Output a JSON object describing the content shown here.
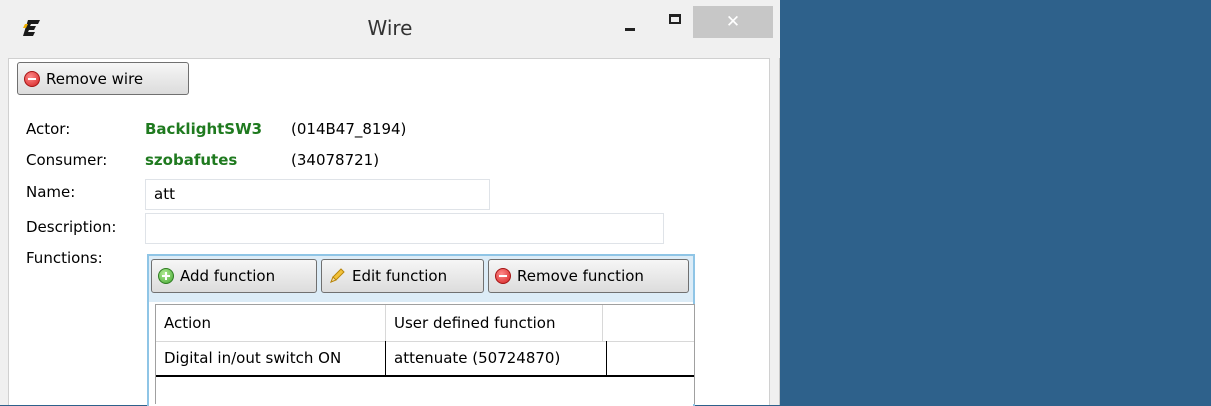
{
  "window": {
    "title": "Wire",
    "close_glyph": "✕",
    "icons": {
      "app": "app-logo-icon",
      "minimize": "minimize-icon",
      "maximize": "maximize-icon",
      "close": "close-icon"
    }
  },
  "toolbar": {
    "remove_wire_label": "Remove wire",
    "remove_wire_icon": "remove-circle-icon"
  },
  "fields": {
    "actor": {
      "label": "Actor:",
      "name": "BacklightSW3",
      "id": "(014B47_8194)"
    },
    "consumer": {
      "label": "Consumer:",
      "name": "szobafutes",
      "id": "(34078721)"
    },
    "name": {
      "label": "Name:",
      "value": "att"
    },
    "description": {
      "label": "Description:",
      "value": ""
    },
    "functions": {
      "label": "Functions:"
    }
  },
  "functions": {
    "buttons": {
      "add": {
        "label": "Add function",
        "icon": "add-circle-icon"
      },
      "edit": {
        "label": "Edit function",
        "icon": "pencil-icon"
      },
      "remove": {
        "label": "Remove function",
        "icon": "remove-circle-icon"
      }
    },
    "table": {
      "columns": [
        "Action",
        "User defined function"
      ],
      "rows": [
        [
          "Digital in/out switch ON",
          "attenuate (50724870)"
        ]
      ]
    }
  },
  "colors": {
    "desktop": "#2e618b",
    "accent_green": "#1f7a1f",
    "panel_border": "#8fc5e6"
  }
}
